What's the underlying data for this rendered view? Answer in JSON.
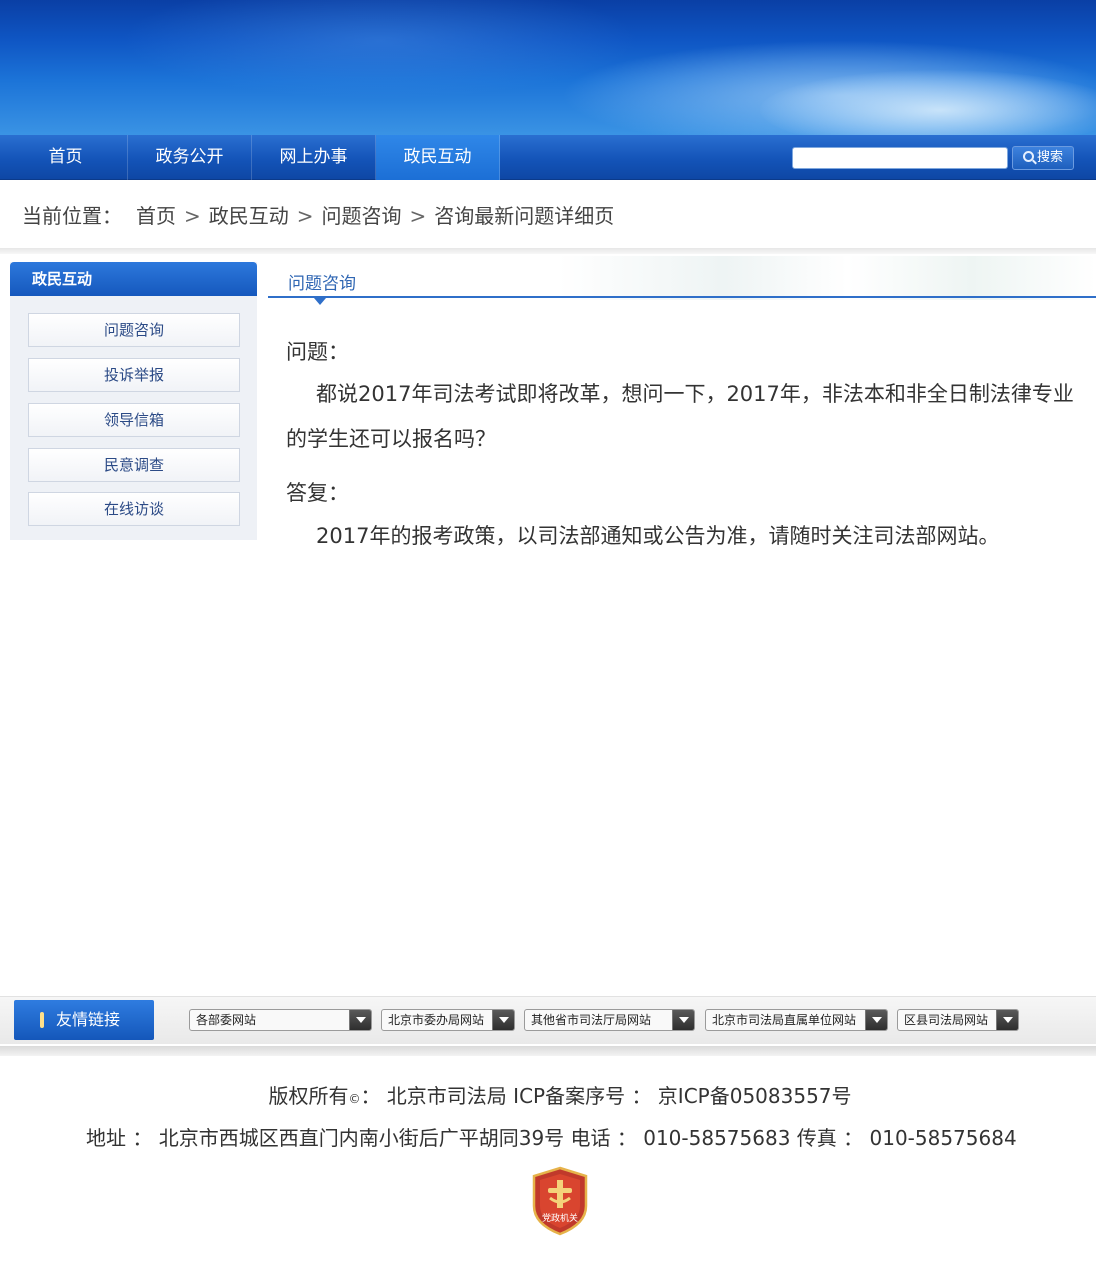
{
  "nav": {
    "items": [
      {
        "label": "首页"
      },
      {
        "label": "政务公开"
      },
      {
        "label": "网上办事"
      },
      {
        "label": "政民互动"
      }
    ],
    "active_index": 3,
    "search": {
      "value": "",
      "button_label": "搜索"
    }
  },
  "breadcrumb": {
    "lead": "当前位置：",
    "items": [
      "首页",
      "政民互动",
      "问题咨询",
      "咨询最新问题详细页"
    ],
    "separator": ">"
  },
  "sidebar": {
    "title": "政民互动",
    "items": [
      {
        "label": "问题咨询"
      },
      {
        "label": "投诉举报"
      },
      {
        "label": "领导信箱"
      },
      {
        "label": "民意调查"
      },
      {
        "label": "在线访谈"
      }
    ]
  },
  "main": {
    "tab_label": "问题咨询",
    "question_label": "问题：",
    "question_text": "都说2017年司法考试即将改革，想问一下，2017年，非法本和非全日制法律专业的学生还可以报名吗？",
    "answer_label": "答复：",
    "answer_text": "2017年的报考政策，以司法部通知或公告为准，请随时关注司法部网站。"
  },
  "friend_links": {
    "title": "友情链接",
    "selects": [
      {
        "label": "各部委网站"
      },
      {
        "label": "北京市委办局网站"
      },
      {
        "label": "其他省市司法厅局网站"
      },
      {
        "label": "北京市司法局直属单位网站"
      },
      {
        "label": "区县司法局网站"
      }
    ]
  },
  "footer": {
    "copyright_prefix": "版权所有",
    "copyright_mark": "©",
    "copyright_rest": "：  北京市司法局  ICP备案序号 ：  京ICP备05083557号",
    "address_line": "地址 ：  北京市西城区西直门内南小街后广平胡同39号  电话 ：  010-58575683  传真 ：  010-58575684",
    "emblem_text": "党政机关"
  },
  "colors": {
    "nav_blue": "#1454b8",
    "link_blue": "#2f66b3",
    "emblem_red": "#c0392b"
  }
}
